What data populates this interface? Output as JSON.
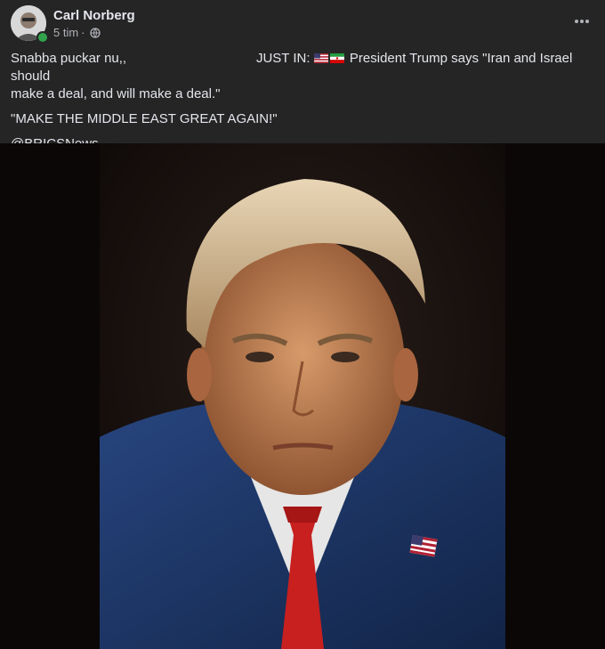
{
  "post": {
    "author": "Carl Norberg",
    "time": "5 tim",
    "separator": "·",
    "text_lead": "Snabba puckar nu,,",
    "text_just_in": "JUST IN:",
    "text_main_line": "President Trump says \"Iran and Israel should",
    "text_main_cont": "make a deal, and will make a deal.\"",
    "quote": "\"MAKE THE MIDDLE EAST GREAT AGAIN!\"",
    "source": "@BRICSNews",
    "flags": [
      "us-flag-icon",
      "iran-flag-icon"
    ]
  },
  "icons": {
    "privacy": "globe-icon",
    "menu": "more-options-icon",
    "status": "online-status-dot"
  },
  "colors": {
    "background": "#252526",
    "text": "#e4e6eb",
    "secondary_text": "#b0b3b8",
    "online": "#31a24c",
    "image_background": "#0b0706"
  }
}
